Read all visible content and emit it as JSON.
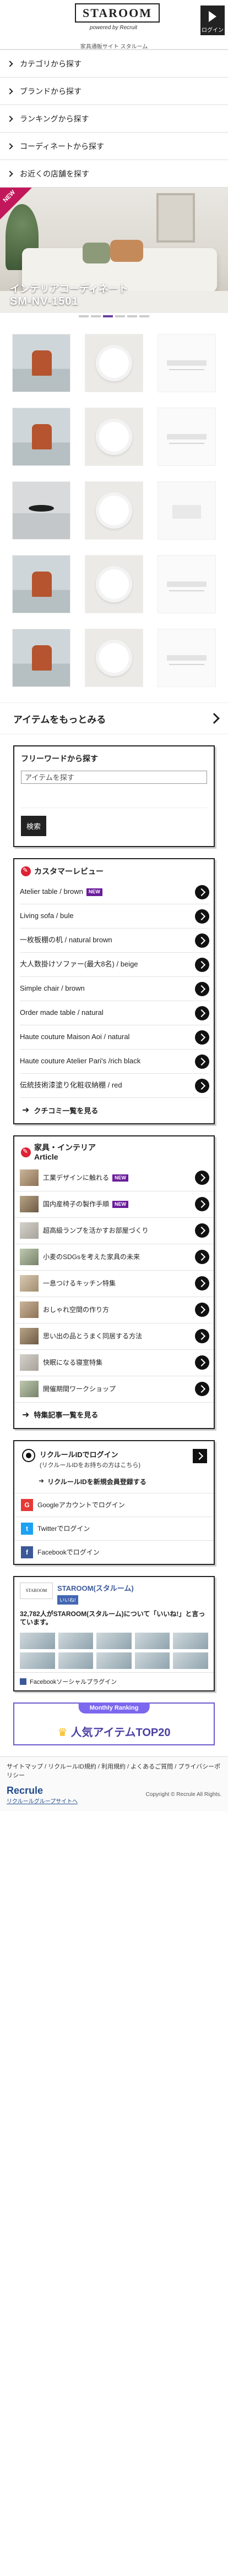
{
  "header": {
    "logo": "STAROOM",
    "powered": "powered by Recruit",
    "subtitle": "家具通販サイト スタルーム",
    "login_label": "ログイン"
  },
  "nav": [
    {
      "label": "カテゴリから探す"
    },
    {
      "label": "ブランドから探す"
    },
    {
      "label": "ランキングから探す"
    },
    {
      "label": "コーディネートから探す"
    },
    {
      "label": "お近くの店舗を探す"
    }
  ],
  "hero": {
    "badge": "NEW",
    "caption_line1": "インテリアコーディネート",
    "caption_line2": "SM-NV-1501"
  },
  "items_more": "アイテムをもっとみる",
  "keyword": {
    "title": "フリーワードから探す",
    "placeholder": "アイテムを探す",
    "button": "検索"
  },
  "reviews": {
    "title": "カスタマーレビュー",
    "items": [
      {
        "text": "Atelier table / brown",
        "badge": "NEW"
      },
      {
        "text": "Living sofa / bule"
      },
      {
        "text": "一枚板棚の机 / natural brown"
      },
      {
        "text": "大人数掛けソファー(最大8名) / beige"
      },
      {
        "text": "Simple chair / brown"
      },
      {
        "text": "Order made table / natural"
      },
      {
        "text": "Haute couture Maison Aoi / natural"
      },
      {
        "text": "Haute couture Atelier Pari's /rich black"
      },
      {
        "text": "伝統技術漆塗り化粧収納棚 / red"
      }
    ],
    "more": "クチコミ一覧を見る"
  },
  "articles": {
    "title_line1": "家具・インテリア",
    "title_line2": "Article",
    "items": [
      {
        "text": "工業デザインに触れる",
        "badge": "NEW"
      },
      {
        "text": "国内産椅子の製作手順",
        "badge": "NEW"
      },
      {
        "text": "超高級ランプを活かすお部屋づくり"
      },
      {
        "text": "小麦のSDGsを考えた家具の未来"
      },
      {
        "text": "一息つけるキッチン特集"
      },
      {
        "text": "おしゃれ空間の作り方"
      },
      {
        "text": "思い出の品とうまく同居する方法"
      },
      {
        "text": "快眠になる寝室特集"
      },
      {
        "text": "開催期間ワークショップ"
      }
    ],
    "more": "特集記事一覧を見る"
  },
  "login_box": {
    "title": "リクルールIDでログイン",
    "note": "(リクルールIDをお持ちの方はこちら)",
    "register": "リクルールIDを新規会員登録する",
    "google": "Googleアカウントでログイン",
    "twitter": "Twitterでログイン",
    "facebook": "Facebookでログイン"
  },
  "fb": {
    "logo_text": "STAROOM",
    "name": "STAROOM(スタルーム)",
    "like": "いいね!",
    "count": "32,782人がSTAROOM(スタルーム)について「いいね!」と言っています。",
    "plugin": "Facebookソーシャルプラグイン"
  },
  "ranking": {
    "top": "Monthly Ranking",
    "main": "人気アイテムTOP20"
  },
  "footer": {
    "links": "サイトマップ / リクルールID規約 / 利用規約 / よくあるご質問 / プライバシーポリシー",
    "logo": "Recrule",
    "sub": "リクルールグループサイトへ",
    "copyright": "Copyright © Recrule All Rights."
  }
}
